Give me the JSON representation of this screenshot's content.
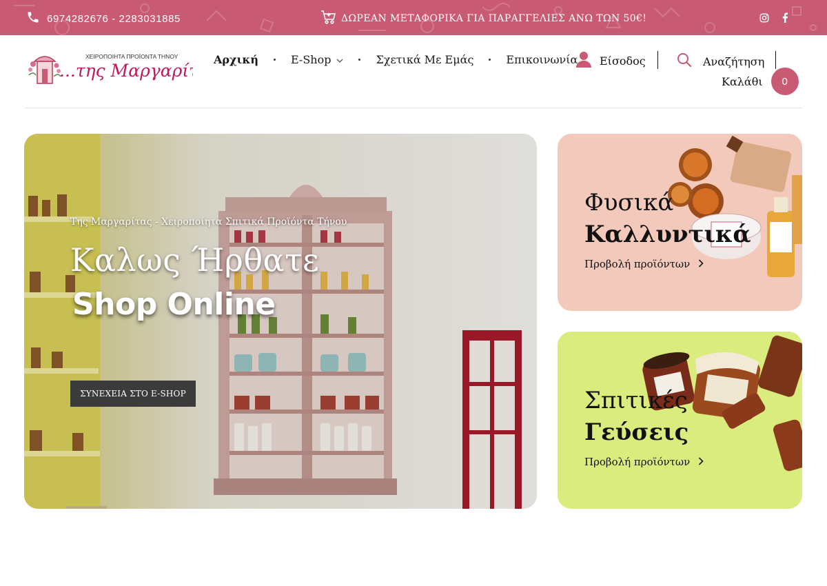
{
  "topbar": {
    "phone": "6974282676 - 2283031885",
    "promo": "ΔΩΡΕΑΝ ΜΕΤΑΦΟΡΙΚΑ ΓΙΑ ΠΑΡΑΓΓΕΛΙΕΣ ΑΝΩ ΤΩΝ 50€!",
    "icons": [
      "phone-icon",
      "cart-icon",
      "instagram-icon",
      "facebook-icon"
    ]
  },
  "logo": {
    "tagline": "ΧΕΙΡΟΠΟΙΗΤΑ ΠΡΟΪΟΝΤΑ ΤΗΝΟΥ",
    "name": "...της Μαργαρίτας"
  },
  "nav": {
    "items": [
      {
        "label": "Αρχική"
      },
      {
        "label": "E-Shop"
      },
      {
        "label": "Σχετικά Με Εμάς"
      },
      {
        "label": "Επικοινωνία"
      }
    ],
    "login": "Είσοδος",
    "search": "Αναζήτηση",
    "cart": "Καλάθι",
    "cart_count": "0"
  },
  "hero": {
    "subtitle": "Της Μαργαρίτας - Χειροποίητα Σπιτικά Προϊόντα Τήνου",
    "welcome": "Καλως Ήρθατε",
    "shop": "Shop Online",
    "cta": "ΣΥΝΕΧΕΙΑ ΣΤΟ E-SHOP"
  },
  "cards": [
    {
      "line1": "Φυσικά",
      "line2": "Καλλυντικά",
      "link": "Προβολή προϊόντων"
    },
    {
      "line1": "Σπιτικές",
      "line2": "Γεύσεις",
      "link": "Προβολή προϊόντων"
    }
  ],
  "colors": {
    "brand": "#c85a74",
    "card1_bg": "#f2c9bb",
    "card2_bg": "#d9ec7d",
    "cta_bg": "#3b3b3b"
  }
}
